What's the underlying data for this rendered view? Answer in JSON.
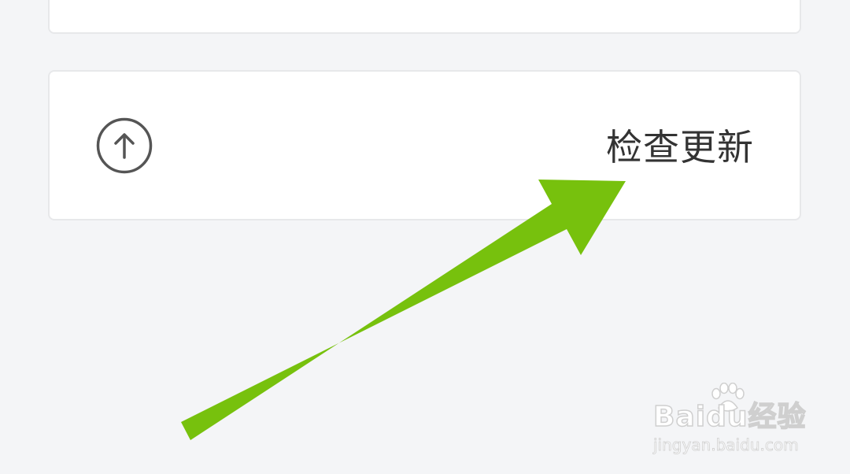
{
  "settings": {
    "check_update": {
      "label": "检查更新",
      "icon": "arrow-up-circle-icon"
    }
  },
  "annotation": {
    "icon": "pointer-arrow",
    "color": "#77c10d"
  },
  "watermark": {
    "brand": "Baidu经验",
    "url": "jingyan.baidu.com"
  },
  "colors": {
    "background": "#f4f5f7",
    "card": "#ffffff",
    "text": "#333333",
    "icon": "#555555",
    "arrow": "#77c10d"
  }
}
